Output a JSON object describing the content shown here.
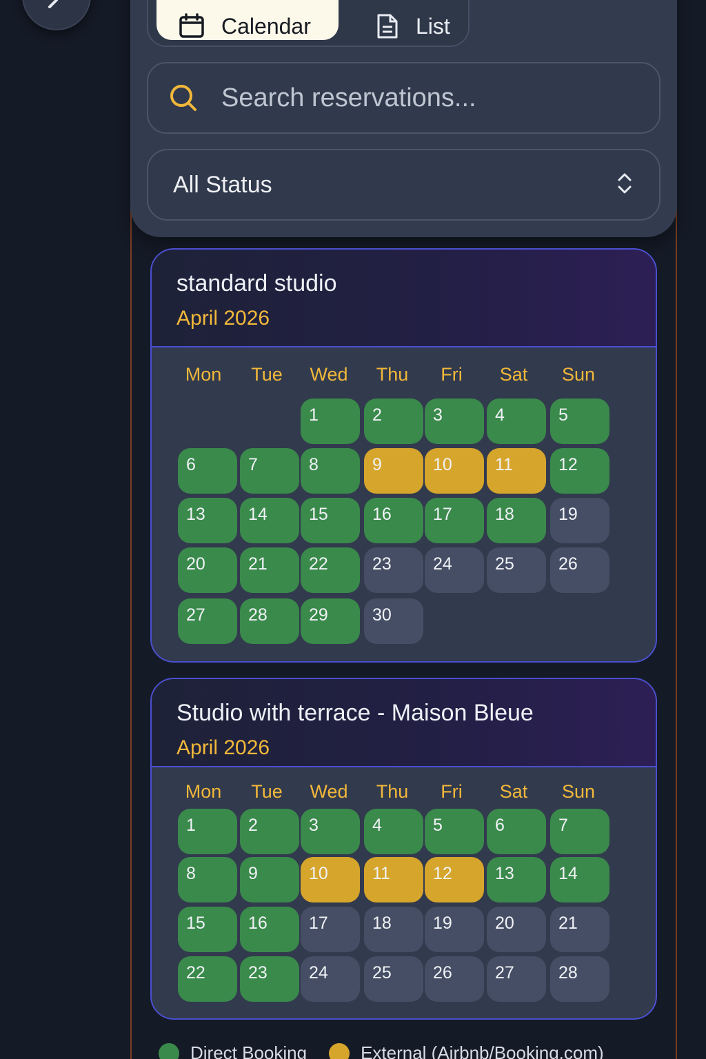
{
  "view_toggle": {
    "calendar_label": "Calendar",
    "list_label": "List",
    "active": "Calendar"
  },
  "search": {
    "placeholder": "Search reservations..."
  },
  "status_filter": {
    "selected": "All Status"
  },
  "colors": {
    "direct": "#3a8a4b",
    "external": "#d6a52c",
    "available": "#454e64",
    "accent": "#f2b83a"
  },
  "weekdays": [
    "Mon",
    "Tue",
    "Wed",
    "Thu",
    "Fri",
    "Sat",
    "Sun"
  ],
  "calendars": [
    {
      "title": "standard studio",
      "month": "April 2026",
      "first_weekday_index": 2,
      "days": [
        {
          "d": "1",
          "s": "direct"
        },
        {
          "d": "2",
          "s": "direct"
        },
        {
          "d": "3",
          "s": "direct"
        },
        {
          "d": "4",
          "s": "direct"
        },
        {
          "d": "5",
          "s": "direct"
        },
        {
          "d": "6",
          "s": "direct"
        },
        {
          "d": "7",
          "s": "direct"
        },
        {
          "d": "8",
          "s": "direct"
        },
        {
          "d": "9",
          "s": "external"
        },
        {
          "d": "10",
          "s": "external"
        },
        {
          "d": "11",
          "s": "external"
        },
        {
          "d": "12",
          "s": "direct"
        },
        {
          "d": "13",
          "s": "direct"
        },
        {
          "d": "14",
          "s": "direct"
        },
        {
          "d": "15",
          "s": "direct"
        },
        {
          "d": "16",
          "s": "direct"
        },
        {
          "d": "17",
          "s": "direct"
        },
        {
          "d": "18",
          "s": "direct"
        },
        {
          "d": "19",
          "s": "free"
        },
        {
          "d": "20",
          "s": "direct"
        },
        {
          "d": "21",
          "s": "direct"
        },
        {
          "d": "22",
          "s": "direct"
        },
        {
          "d": "23",
          "s": "free"
        },
        {
          "d": "24",
          "s": "free"
        },
        {
          "d": "25",
          "s": "free"
        },
        {
          "d": "26",
          "s": "free"
        },
        {
          "d": "27",
          "s": "direct"
        },
        {
          "d": "28",
          "s": "direct"
        },
        {
          "d": "29",
          "s": "direct"
        },
        {
          "d": "30",
          "s": "free"
        }
      ]
    },
    {
      "title": "Studio with terrace - Maison Bleue",
      "month": "April 2026",
      "first_weekday_index": 0,
      "days": [
        {
          "d": "1",
          "s": "direct"
        },
        {
          "d": "2",
          "s": "direct"
        },
        {
          "d": "3",
          "s": "direct"
        },
        {
          "d": "4",
          "s": "direct"
        },
        {
          "d": "5",
          "s": "direct"
        },
        {
          "d": "6",
          "s": "direct"
        },
        {
          "d": "7",
          "s": "direct"
        },
        {
          "d": "8",
          "s": "direct"
        },
        {
          "d": "9",
          "s": "direct"
        },
        {
          "d": "10",
          "s": "external"
        },
        {
          "d": "11",
          "s": "external"
        },
        {
          "d": "12",
          "s": "external"
        },
        {
          "d": "13",
          "s": "direct"
        },
        {
          "d": "14",
          "s": "direct"
        },
        {
          "d": "15",
          "s": "direct"
        },
        {
          "d": "16",
          "s": "direct"
        },
        {
          "d": "17",
          "s": "free"
        },
        {
          "d": "18",
          "s": "free"
        },
        {
          "d": "19",
          "s": "free"
        },
        {
          "d": "20",
          "s": "free"
        },
        {
          "d": "21",
          "s": "free"
        },
        {
          "d": "22",
          "s": "direct"
        },
        {
          "d": "23",
          "s": "direct"
        },
        {
          "d": "24",
          "s": "free"
        },
        {
          "d": "25",
          "s": "free"
        },
        {
          "d": "26",
          "s": "free"
        },
        {
          "d": "27",
          "s": "free"
        },
        {
          "d": "28",
          "s": "free"
        }
      ]
    }
  ],
  "legend": [
    {
      "label": "Direct Booking",
      "color": "#3a8a4b"
    },
    {
      "label": "External (Airbnb/Booking.com)",
      "color": "#d6a52c"
    }
  ]
}
